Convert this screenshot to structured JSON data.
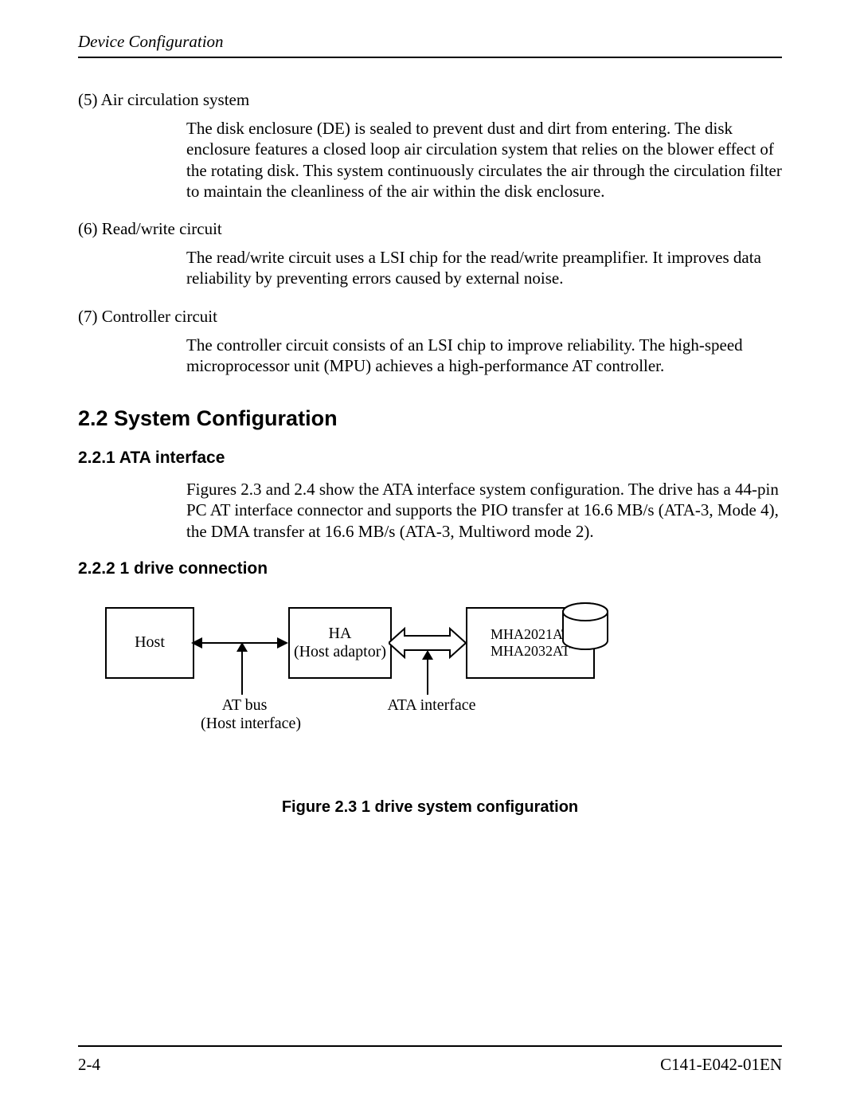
{
  "header": {
    "title": "Device Configuration"
  },
  "items": {
    "i5": {
      "label": "(5)  Air circulation system",
      "text": "The disk enclosure (DE) is sealed to prevent dust and dirt from entering.  The disk enclosure features a closed loop air circulation system that relies on the blower effect of the rotating disk.  This system continuously circulates the air through the circulation filter to maintain the cleanliness of the air within the disk enclosure."
    },
    "i6": {
      "label": "(6)  Read/write circuit",
      "text": "The read/write circuit uses a LSI chip for the read/write preamplifier.  It improves data reliability by preventing errors caused by external noise."
    },
    "i7": {
      "label": "(7)  Controller circuit",
      "text": "The controller circuit consists of an LSI chip to improve reliability.  The high-speed microprocessor unit (MPU) achieves a high-performance AT controller."
    }
  },
  "sec22": {
    "title": "2.2  System Configuration"
  },
  "sec221": {
    "title": "2.2.1  ATA interface",
    "text": "Figures 2.3 and 2.4 show the ATA interface system configuration.  The drive has a 44-pin PC AT interface connector and supports the PIO transfer at 16.6 MB/s (ATA-3, Mode 4), the DMA transfer at 16.6 MB/s (ATA-3, Multiword mode 2)."
  },
  "sec222": {
    "title": "2.2.2  1 drive connection"
  },
  "figure": {
    "host": "Host",
    "ha_line1": "HA",
    "ha_line2": "(Host adaptor)",
    "drive_line1": "MHA2021AT",
    "drive_line2": "MHA2032AT",
    "atbus_line1": "AT bus",
    "atbus_line2": "(Host interface)",
    "ata_if": "ATA interface",
    "caption": "Figure 2.3  1 drive system configuration"
  },
  "footer": {
    "page": "2-4",
    "doc": "C141-E042-01EN"
  }
}
